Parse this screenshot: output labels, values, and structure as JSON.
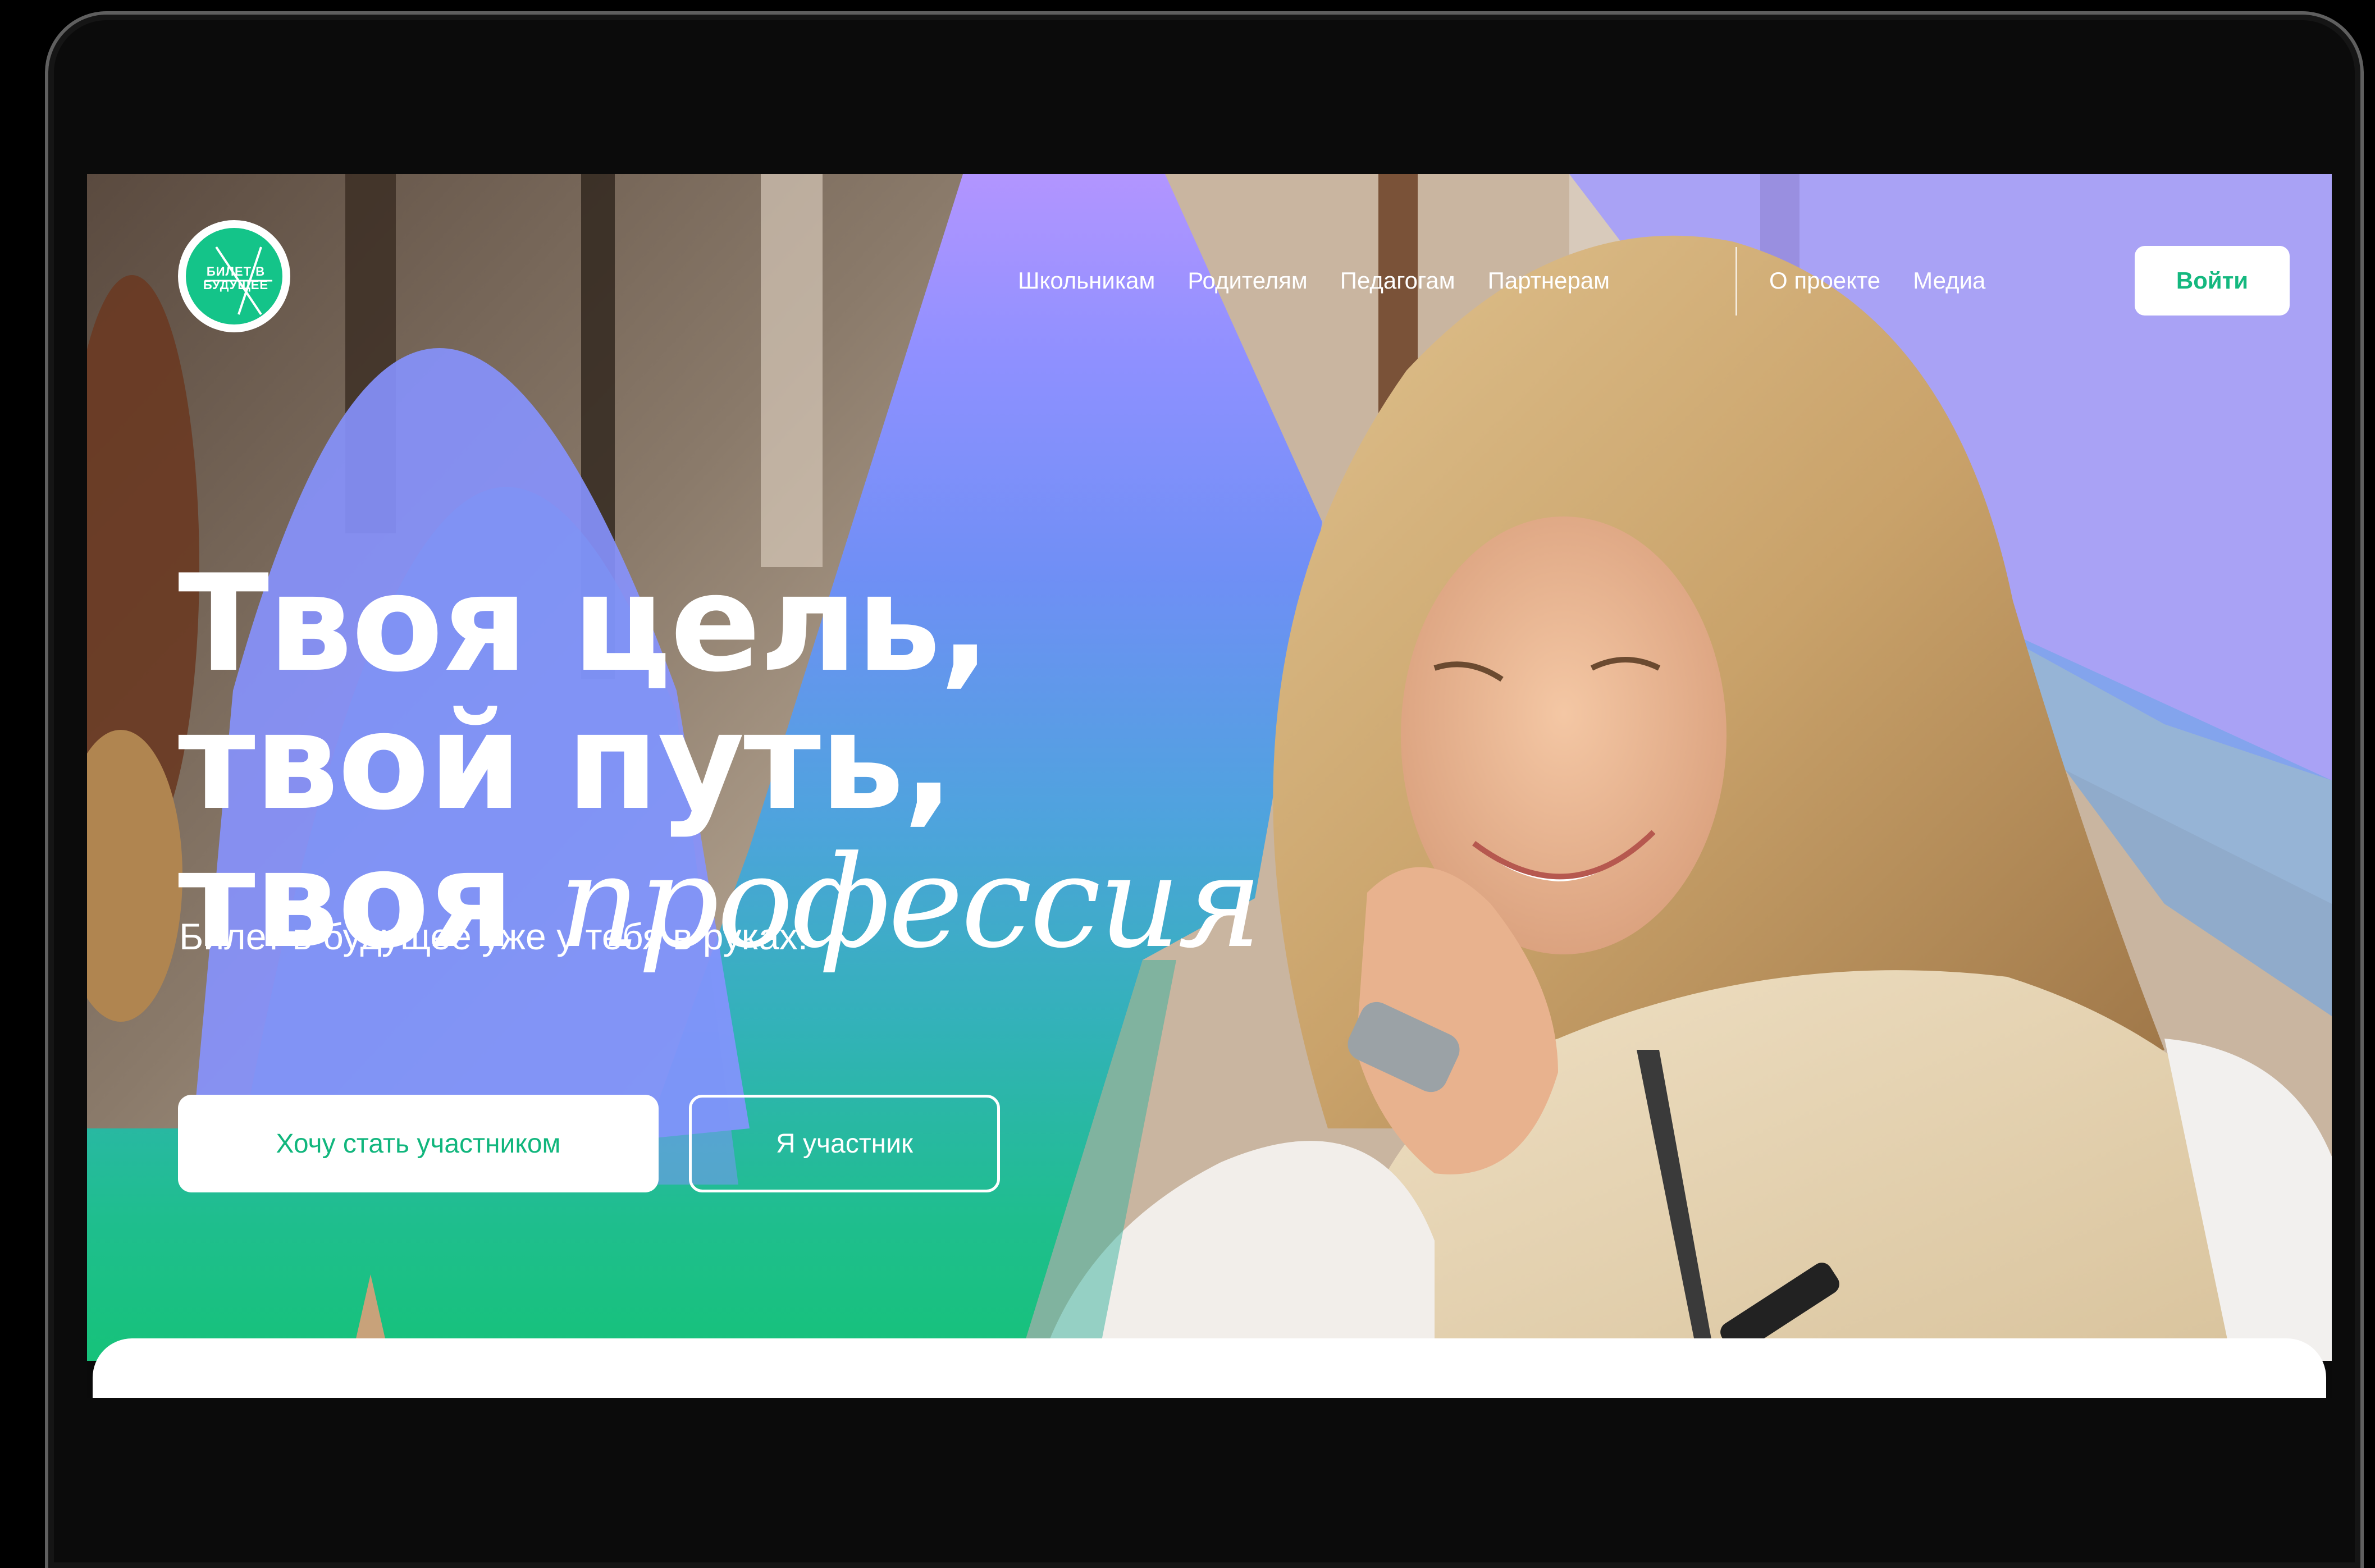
{
  "logo": {
    "text": "БИЛЕТ В\nБУДУЩЕЕ"
  },
  "nav": {
    "primary": [
      "Школьникам",
      "Родителям",
      "Педагогам",
      "Партнерам"
    ],
    "secondary": [
      "О проекте",
      "Медиа"
    ],
    "login_label": "Войти"
  },
  "hero": {
    "headline_line1": "Твоя цель,",
    "headline_line2": "твой путь,",
    "headline_line3_a": "твоя ",
    "headline_line3_b": "профессия",
    "subtitle": "Билет в будущее уже у тебя в руках!",
    "cta_primary": "Хочу стать участником",
    "cta_secondary": "Я участник"
  },
  "colors": {
    "accent_green": "#14c489",
    "gradient_top": "#b295ff",
    "gradient_bottom": "#16c27a"
  }
}
